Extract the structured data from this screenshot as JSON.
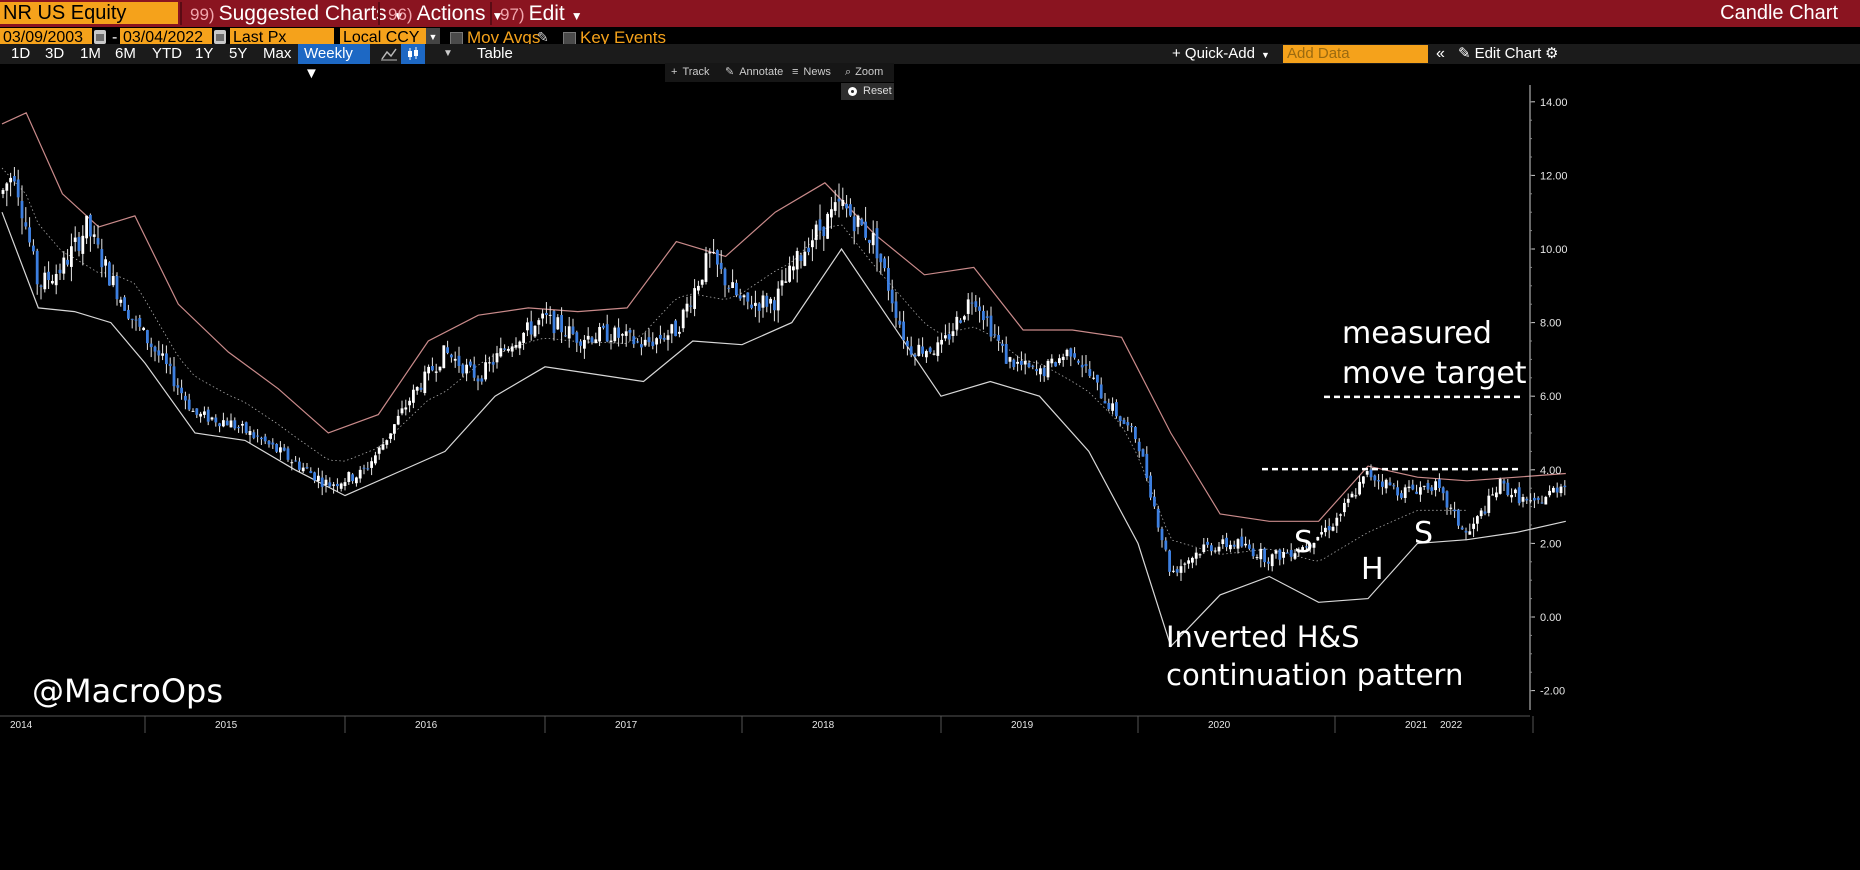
{
  "toolbar": {
    "ticker": "NR US Equity",
    "menu": [
      {
        "num": "99)",
        "label": "Suggested Charts"
      },
      {
        "num": "96)",
        "label": "Actions"
      },
      {
        "num": "97)",
        "label": "Edit"
      }
    ],
    "chart_type": "Candle Chart"
  },
  "settings": {
    "start_date": "03/09/2003",
    "end_date": "03/04/2022",
    "price_field": "Last Px",
    "currency": "Local CCY",
    "mov_avgs": "Mov Avgs",
    "key_events": "Key Events"
  },
  "ranges": {
    "buttons": [
      "1D",
      "3D",
      "1M",
      "6M",
      "YTD",
      "1Y",
      "5Y",
      "Max"
    ],
    "period": "Weekly ▼",
    "table": "Table",
    "quick_add": "+ Quick-Add",
    "add_data_placeholder": "Add Data",
    "edit_chart": "Edit Chart"
  },
  "chart_tools": {
    "track": "Track",
    "annotate": "Annotate",
    "news": "News",
    "zoom": "Zoom",
    "reset": "Reset"
  },
  "annotations": {
    "target_line1": "measured",
    "target_line2": "move target",
    "pattern_line1": "Inverted H&S",
    "pattern_line2": "continuation pattern",
    "left_shoulder": "S",
    "head": "H",
    "right_shoulder": "S",
    "watermark": "@MacroOps"
  },
  "colors": {
    "command_bar": "#8a1420",
    "field": "#f5a21b",
    "candle": "#3d7fe0",
    "band_upper": "#c98a8a",
    "band_lower": "#d8d8d8"
  },
  "chart_data": {
    "type": "candlestick",
    "period": "Weekly",
    "ylim": [
      -2.3,
      14.5
    ],
    "y_ticks": [
      "14.00",
      "12.00",
      "10.00",
      "8.00",
      "6.00",
      "4.00",
      "2.00",
      "0.00",
      "-2.00"
    ],
    "x_ticks": [
      "2014",
      "2015",
      "2016",
      "2017",
      "2018",
      "2019",
      "2020",
      "2021",
      "2022"
    ],
    "price_path": [
      [
        "2014-01",
        11.5
      ],
      [
        "2014-02",
        12.2
      ],
      [
        "2014-04",
        9.0
      ],
      [
        "2014-06",
        9.5
      ],
      [
        "2014-08",
        10.6
      ],
      [
        "2014-10",
        9.2
      ],
      [
        "2014-12",
        8.0
      ],
      [
        "2015-02",
        7.0
      ],
      [
        "2015-04",
        5.5
      ],
      [
        "2015-06",
        5.3
      ],
      [
        "2015-08",
        4.8
      ],
      [
        "2015-10",
        4.2
      ],
      [
        "2015-12",
        3.6
      ],
      [
        "2016-02",
        3.9
      ],
      [
        "2016-03",
        4.5
      ],
      [
        "2016-05",
        6.0
      ],
      [
        "2016-07",
        7.2
      ],
      [
        "2016-09",
        6.5
      ],
      [
        "2016-11",
        7.5
      ],
      [
        "2017-01",
        8.1
      ],
      [
        "2017-03",
        7.6
      ],
      [
        "2017-05",
        7.7
      ],
      [
        "2017-07",
        7.4
      ],
      [
        "2017-09",
        7.8
      ],
      [
        "2017-11",
        9.8
      ],
      [
        "2018-01",
        8.5
      ],
      [
        "2018-03",
        8.6
      ],
      [
        "2018-05",
        10.2
      ],
      [
        "2018-07",
        11.2
      ],
      [
        "2018-09",
        10.2
      ],
      [
        "2018-11",
        7.3
      ],
      [
        "2019-01",
        7.3
      ],
      [
        "2019-03",
        8.8
      ],
      [
        "2019-05",
        7.0
      ],
      [
        "2019-07",
        6.6
      ],
      [
        "2019-09",
        7.3
      ],
      [
        "2019-11",
        5.9
      ],
      [
        "2020-01",
        4.8
      ],
      [
        "2020-03",
        1.2
      ],
      [
        "2020-05",
        1.9
      ],
      [
        "2020-07",
        2.0
      ],
      [
        "2020-09",
        1.6
      ],
      [
        "2020-11",
        1.9
      ],
      [
        "2021-01",
        2.6
      ],
      [
        "2021-03",
        3.9
      ],
      [
        "2021-05",
        3.4
      ],
      [
        "2021-07",
        3.6
      ],
      [
        "2021-09",
        2.2
      ],
      [
        "2021-11",
        3.6
      ],
      [
        "2022-01",
        3.0
      ],
      [
        "2022-03",
        3.7
      ]
    ],
    "upper_band": [
      [
        "2014-01",
        13.4
      ],
      [
        "2014-03",
        13.7
      ],
      [
        "2014-06",
        11.5
      ],
      [
        "2014-09",
        10.6
      ],
      [
        "2014-12",
        10.9
      ],
      [
        "2015-03",
        8.5
      ],
      [
        "2015-06",
        7.2
      ],
      [
        "2015-09",
        6.2
      ],
      [
        "2015-12",
        5.0
      ],
      [
        "2016-03",
        5.5
      ],
      [
        "2016-06",
        7.5
      ],
      [
        "2016-09",
        8.2
      ],
      [
        "2016-12",
        8.4
      ],
      [
        "2017-03",
        8.3
      ],
      [
        "2017-06",
        8.4
      ],
      [
        "2017-09",
        10.2
      ],
      [
        "2017-12",
        9.8
      ],
      [
        "2018-03",
        11.0
      ],
      [
        "2018-06",
        11.8
      ],
      [
        "2018-09",
        10.4
      ],
      [
        "2018-12",
        9.3
      ],
      [
        "2019-03",
        9.5
      ],
      [
        "2019-06",
        7.8
      ],
      [
        "2019-09",
        7.8
      ],
      [
        "2019-12",
        7.6
      ],
      [
        "2020-03",
        5.0
      ],
      [
        "2020-06",
        2.8
      ],
      [
        "2020-09",
        2.6
      ],
      [
        "2020-12",
        2.6
      ],
      [
        "2021-03",
        4.1
      ],
      [
        "2021-06",
        3.8
      ],
      [
        "2021-09",
        3.7
      ],
      [
        "2021-12",
        3.8
      ],
      [
        "2022-03",
        3.9
      ]
    ],
    "lower_band": [
      [
        "2014-01",
        11.0
      ],
      [
        "2014-04",
        8.4
      ],
      [
        "2014-07",
        8.3
      ],
      [
        "2014-10",
        8.0
      ],
      [
        "2015-01",
        6.9
      ],
      [
        "2015-04",
        5.0
      ],
      [
        "2015-07",
        4.8
      ],
      [
        "2015-10",
        4.0
      ],
      [
        "2016-01",
        3.3
      ],
      [
        "2016-04",
        3.9
      ],
      [
        "2016-07",
        4.5
      ],
      [
        "2016-10",
        6.0
      ],
      [
        "2017-01",
        6.8
      ],
      [
        "2017-04",
        6.6
      ],
      [
        "2017-07",
        6.4
      ],
      [
        "2017-10",
        7.5
      ],
      [
        "2018-01",
        7.4
      ],
      [
        "2018-04",
        8.0
      ],
      [
        "2018-07",
        10.0
      ],
      [
        "2018-10",
        8.0
      ],
      [
        "2019-01",
        6.0
      ],
      [
        "2019-04",
        6.4
      ],
      [
        "2019-07",
        6.0
      ],
      [
        "2019-10",
        4.5
      ],
      [
        "2020-01",
        2.0
      ],
      [
        "2020-03",
        -0.8
      ],
      [
        "2020-06",
        0.6
      ],
      [
        "2020-09",
        1.1
      ],
      [
        "2020-12",
        0.4
      ],
      [
        "2021-03",
        0.5
      ],
      [
        "2021-06",
        2.0
      ],
      [
        "2021-09",
        2.1
      ],
      [
        "2021-12",
        2.3
      ],
      [
        "2022-03",
        2.6
      ]
    ],
    "neckline": 4.02,
    "target": 5.98
  }
}
